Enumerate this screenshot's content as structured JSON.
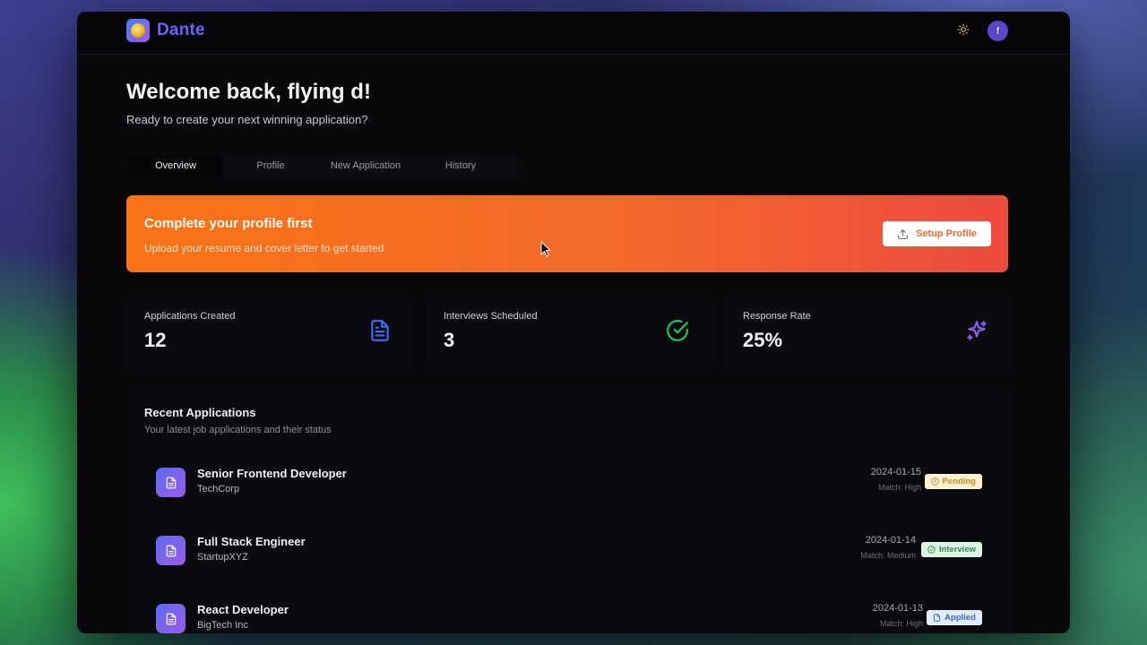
{
  "header": {
    "brand": "Dante",
    "avatar_initial": "f",
    "theme_icon": "sun-icon"
  },
  "welcome": {
    "title": "Welcome back, flying d!",
    "subtitle": "Ready to create your next winning application?"
  },
  "tabs": [
    {
      "label": "Overview",
      "active": true
    },
    {
      "label": "Profile",
      "active": false
    },
    {
      "label": "New Application",
      "active": false
    },
    {
      "label": "History",
      "active": false
    }
  ],
  "banner": {
    "title": "Complete your profile first",
    "subtitle": "Upload your resume and cover letter to get started",
    "button_label": "Setup Profile"
  },
  "stats": [
    {
      "label": "Applications Created",
      "value": "12",
      "icon": "file-text-icon",
      "color": "#3b6cf5"
    },
    {
      "label": "Interviews Scheduled",
      "value": "3",
      "icon": "check-circle-icon",
      "color": "#22c55e"
    },
    {
      "label": "Response Rate",
      "value": "25%",
      "icon": "sparkles-icon",
      "color": "#8b5cf6"
    }
  ],
  "recent": {
    "title": "Recent Applications",
    "subtitle": "Your latest job applications and their status",
    "items": [
      {
        "title": "Senior Frontend Developer",
        "company": "TechCorp",
        "date": "2024-01-15",
        "match": "Match: High",
        "status": "Pending"
      },
      {
        "title": "Full Stack Engineer",
        "company": "StartupXYZ",
        "date": "2024-01-14",
        "match": "Match: Medium",
        "status": "Interview"
      },
      {
        "title": "React Developer",
        "company": "BigTech Inc",
        "date": "2024-01-13",
        "match": "Match: High",
        "status": "Applied"
      }
    ]
  },
  "colors": {
    "accent": "#6d63ff",
    "banner_start": "#f97316",
    "banner_end": "#ee4a3f"
  }
}
